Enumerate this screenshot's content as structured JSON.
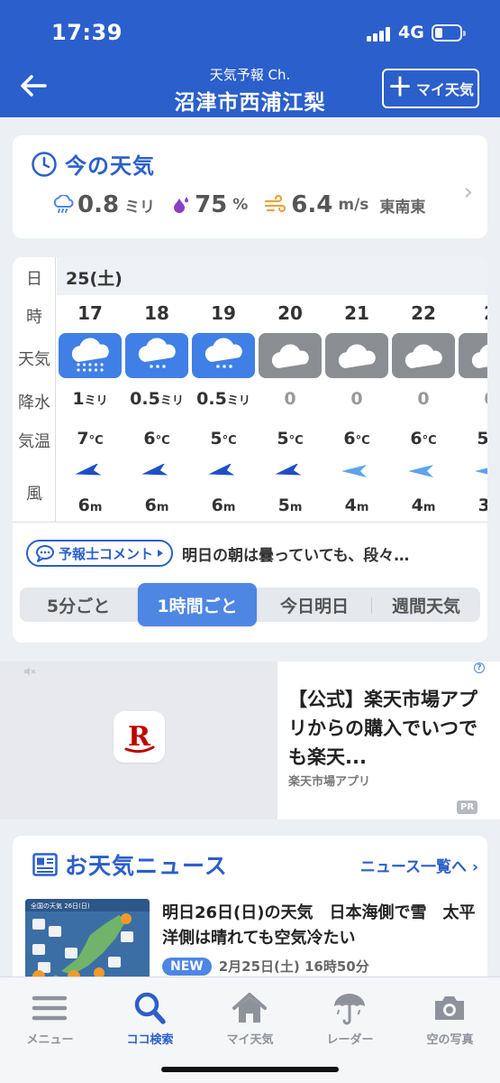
{
  "status_bar": {
    "time": "17:39",
    "network": "4G"
  },
  "header": {
    "subtitle": "天気予報 Ch.",
    "title": "沼津市西浦江梨",
    "my_weather_button": "マイ天気"
  },
  "current_weather": {
    "heading": "今の天気",
    "precipitation": {
      "value": "0.8",
      "unit": "ミリ",
      "icon": "rain-cloud-icon"
    },
    "humidity": {
      "value": "75",
      "unit": "%",
      "icon": "humidity-drop-icon"
    },
    "wind": {
      "value": "6.4",
      "unit": "m/s",
      "direction": "東南東",
      "icon": "wind-icon"
    }
  },
  "hourly": {
    "row_labels": {
      "day": "日",
      "hour": "時",
      "weather": "天気",
      "precip": "降水",
      "temp": "気温",
      "wind": "風"
    },
    "day": "25(土)",
    "hours": [
      {
        "hour": "17",
        "weather": "heavy-rain",
        "precip": "1",
        "precip_unit": "ミリ",
        "temp": "7",
        "temp_unit": "°C",
        "wind_dir": "east-southeast",
        "wind_speed": "6",
        "wind_unit": "m"
      },
      {
        "hour": "18",
        "weather": "light-rain",
        "precip": "0.5",
        "precip_unit": "ミリ",
        "temp": "6",
        "temp_unit": "°C",
        "wind_dir": "east-southeast",
        "wind_speed": "6",
        "wind_unit": "m"
      },
      {
        "hour": "19",
        "weather": "light-rain",
        "precip": "0.5",
        "precip_unit": "ミリ",
        "temp": "5",
        "temp_unit": "°C",
        "wind_dir": "east-southeast",
        "wind_speed": "6",
        "wind_unit": "m"
      },
      {
        "hour": "20",
        "weather": "cloudy",
        "precip": "0",
        "precip_unit": "",
        "temp": "5",
        "temp_unit": "°C",
        "wind_dir": "east-southeast",
        "wind_speed": "5",
        "wind_unit": "m"
      },
      {
        "hour": "21",
        "weather": "cloudy",
        "precip": "0",
        "precip_unit": "",
        "temp": "6",
        "temp_unit": "°C",
        "wind_dir": "east",
        "wind_speed": "4",
        "wind_unit": "m"
      },
      {
        "hour": "22",
        "weather": "cloudy",
        "precip": "0",
        "precip_unit": "",
        "temp": "6",
        "temp_unit": "°C",
        "wind_dir": "east",
        "wind_speed": "4",
        "wind_unit": "m"
      },
      {
        "hour": "2",
        "weather": "cloudy",
        "precip": "0",
        "precip_unit": "",
        "temp": "5",
        "temp_unit": "°C",
        "wind_dir": "east",
        "wind_speed": "3",
        "wind_unit": "m"
      }
    ],
    "comment_button": "予報士コメント",
    "comment_text": "明日の朝は曇っていても、段々…",
    "segments": [
      "5分ごと",
      "1時間ごと",
      "今日明日",
      "週間天気"
    ],
    "active_segment": "1時間ごと"
  },
  "ad": {
    "title": "【公式】楽天市場アプリからの購入でいつでも楽天...",
    "sponsor": "楽天市場アプリ",
    "pr_label": "PR",
    "info_label": "?",
    "logo_letter": "R"
  },
  "news": {
    "heading": "お天気ニュース",
    "more_link": "ニュース一覧へ",
    "item": {
      "title": "明日26日(日)の天気　日本海側で雪　太平洋側は晴れても空気冷たい",
      "badge": "NEW",
      "date": "2月25日(土) 16時50分",
      "thumb_caption": "全国の天気 26日(日)"
    }
  },
  "tabbar": {
    "tabs": [
      {
        "label": "メニュー",
        "icon": "menu-icon"
      },
      {
        "label": "ココ検索",
        "icon": "search-icon"
      },
      {
        "label": "マイ天気",
        "icon": "home-icon"
      },
      {
        "label": "レーダー",
        "icon": "radar-umbrella-icon"
      },
      {
        "label": "空の写真",
        "icon": "camera-icon"
      }
    ],
    "active": "ココ検索"
  },
  "colors": {
    "brand_blue": "#2b5fcb",
    "rain_tile": "#3f7fe6",
    "cloud_tile": "#8a8d92",
    "wind_arrow_dark": "#1f4fc6",
    "wind_arrow_light": "#5ea3ea"
  }
}
